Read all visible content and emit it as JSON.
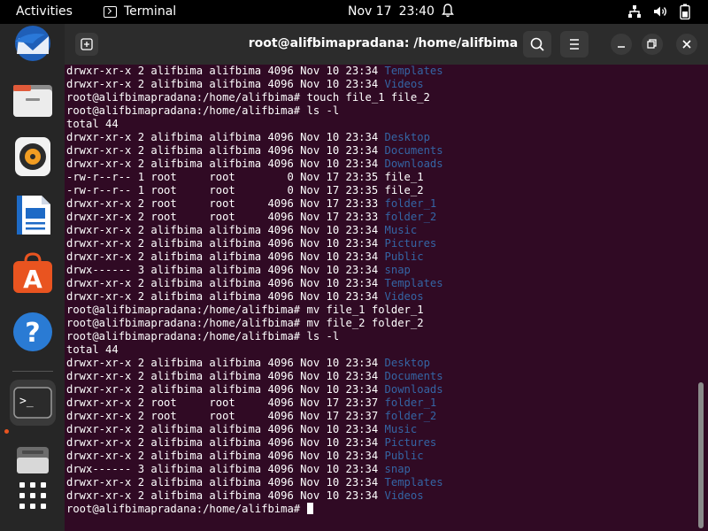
{
  "topbar": {
    "activities": "Activities",
    "app_name": "Terminal",
    "date": "Nov 17",
    "time": "23:40"
  },
  "dock": {
    "items": [
      "thunderbird-icon",
      "files-icon",
      "rhythmbox-icon",
      "writer-icon",
      "app-center-icon",
      "help-icon",
      "terminal-icon",
      "disk-icon",
      "show-apps-icon"
    ],
    "active": "terminal-icon"
  },
  "window": {
    "title": "root@alifbimapradana: /home/alifbima"
  },
  "colors": {
    "terminal_bg": "#300a24",
    "directory": "#3465a4",
    "accent": "#e95420"
  },
  "terminal": {
    "lines": [
      {
        "text": "drwxr-xr-x 2 alifbima alifbima 4096 Nov 10 23:34 ",
        "dir": "Templates"
      },
      {
        "text": "drwxr-xr-x 2 alifbima alifbima 4096 Nov 10 23:34 ",
        "dir": "Videos"
      },
      {
        "text": "root@alifbimapradana:/home/alifbima# touch file_1 file_2"
      },
      {
        "text": "root@alifbimapradana:/home/alifbima# ls -l"
      },
      {
        "text": "total 44"
      },
      {
        "text": "drwxr-xr-x 2 alifbima alifbima 4096 Nov 10 23:34 ",
        "dir": "Desktop"
      },
      {
        "text": "drwxr-xr-x 2 alifbima alifbima 4096 Nov 10 23:34 ",
        "dir": "Documents"
      },
      {
        "text": "drwxr-xr-x 2 alifbima alifbima 4096 Nov 10 23:34 ",
        "dir": "Downloads"
      },
      {
        "text": "-rw-r--r-- 1 root     root        0 Nov 17 23:35 file_1"
      },
      {
        "text": "-rw-r--r-- 1 root     root        0 Nov 17 23:35 file_2"
      },
      {
        "text": "drwxr-xr-x 2 root     root     4096 Nov 17 23:33 ",
        "dir": "folder_1"
      },
      {
        "text": "drwxr-xr-x 2 root     root     4096 Nov 17 23:33 ",
        "dir": "folder_2"
      },
      {
        "text": "drwxr-xr-x 2 alifbima alifbima 4096 Nov 10 23:34 ",
        "dir": "Music"
      },
      {
        "text": "drwxr-xr-x 2 alifbima alifbima 4096 Nov 10 23:34 ",
        "dir": "Pictures"
      },
      {
        "text": "drwxr-xr-x 2 alifbima alifbima 4096 Nov 10 23:34 ",
        "dir": "Public"
      },
      {
        "text": "drwx------ 3 alifbima alifbima 4096 Nov 10 23:34 ",
        "dir": "snap"
      },
      {
        "text": "drwxr-xr-x 2 alifbima alifbima 4096 Nov 10 23:34 ",
        "dir": "Templates"
      },
      {
        "text": "drwxr-xr-x 2 alifbima alifbima 4096 Nov 10 23:34 ",
        "dir": "Videos"
      },
      {
        "text": "root@alifbimapradana:/home/alifbima# mv file_1 folder_1"
      },
      {
        "text": "root@alifbimapradana:/home/alifbima# mv file_2 folder_2"
      },
      {
        "text": "root@alifbimapradana:/home/alifbima# ls -l"
      },
      {
        "text": "total 44"
      },
      {
        "text": "drwxr-xr-x 2 alifbima alifbima 4096 Nov 10 23:34 ",
        "dir": "Desktop"
      },
      {
        "text": "drwxr-xr-x 2 alifbima alifbima 4096 Nov 10 23:34 ",
        "dir": "Documents"
      },
      {
        "text": "drwxr-xr-x 2 alifbima alifbima 4096 Nov 10 23:34 ",
        "dir": "Downloads"
      },
      {
        "text": "drwxr-xr-x 2 root     root     4096 Nov 17 23:37 ",
        "dir": "folder_1"
      },
      {
        "text": "drwxr-xr-x 2 root     root     4096 Nov 17 23:37 ",
        "dir": "folder_2"
      },
      {
        "text": "drwxr-xr-x 2 alifbima alifbima 4096 Nov 10 23:34 ",
        "dir": "Music"
      },
      {
        "text": "drwxr-xr-x 2 alifbima alifbima 4096 Nov 10 23:34 ",
        "dir": "Pictures"
      },
      {
        "text": "drwxr-xr-x 2 alifbima alifbima 4096 Nov 10 23:34 ",
        "dir": "Public"
      },
      {
        "text": "drwx------ 3 alifbima alifbima 4096 Nov 10 23:34 ",
        "dir": "snap"
      },
      {
        "text": "drwxr-xr-x 2 alifbima alifbima 4096 Nov 10 23:34 ",
        "dir": "Templates"
      },
      {
        "text": "drwxr-xr-x 2 alifbima alifbima 4096 Nov 10 23:34 ",
        "dir": "Videos"
      }
    ],
    "prompt": "root@alifbimapradana:/home/alifbima# "
  }
}
